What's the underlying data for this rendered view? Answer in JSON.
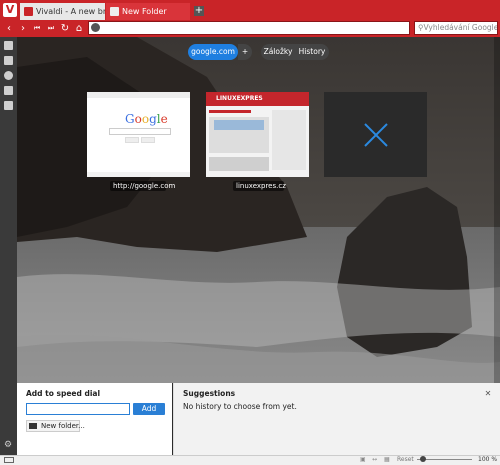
{
  "tabs": [
    {
      "label": "Vivaldi - A new browser fo"
    },
    {
      "label": "New Folder"
    }
  ],
  "browser": {
    "logo": "V",
    "new_tab_symbol": "+",
    "search_placeholder": "Vyhledávání Google",
    "url_value": ""
  },
  "nav": {
    "back": "‹",
    "forward": "›",
    "rewind": "⏮",
    "fastforward": "⏭",
    "reload": "↻",
    "home": "⌂"
  },
  "speed_dial": {
    "folder_button": "google.com",
    "add_button": "+",
    "bookmarks_button": "Záložky",
    "history_button": "History",
    "dials": [
      {
        "label": "http://google.com"
      },
      {
        "label": "linuxexpres.cz"
      },
      {
        "label": ""
      }
    ]
  },
  "add_panel": {
    "title": "Add to speed dial",
    "input_value": "",
    "add_label": "Add",
    "new_folder_label": "New folder...",
    "suggestions_title": "Suggestions",
    "suggestions_text": "No history to choose from yet.",
    "close_symbol": "✕"
  },
  "status": {
    "reset_label": "Reset",
    "zoom_label": "100 %",
    "zoom_level": 1.0
  },
  "colors": {
    "accent": "#c92428",
    "speed_dial_active": "#1f7fe0",
    "add_button": "#2a7fd5",
    "delete_x": "#2b8ae0"
  }
}
